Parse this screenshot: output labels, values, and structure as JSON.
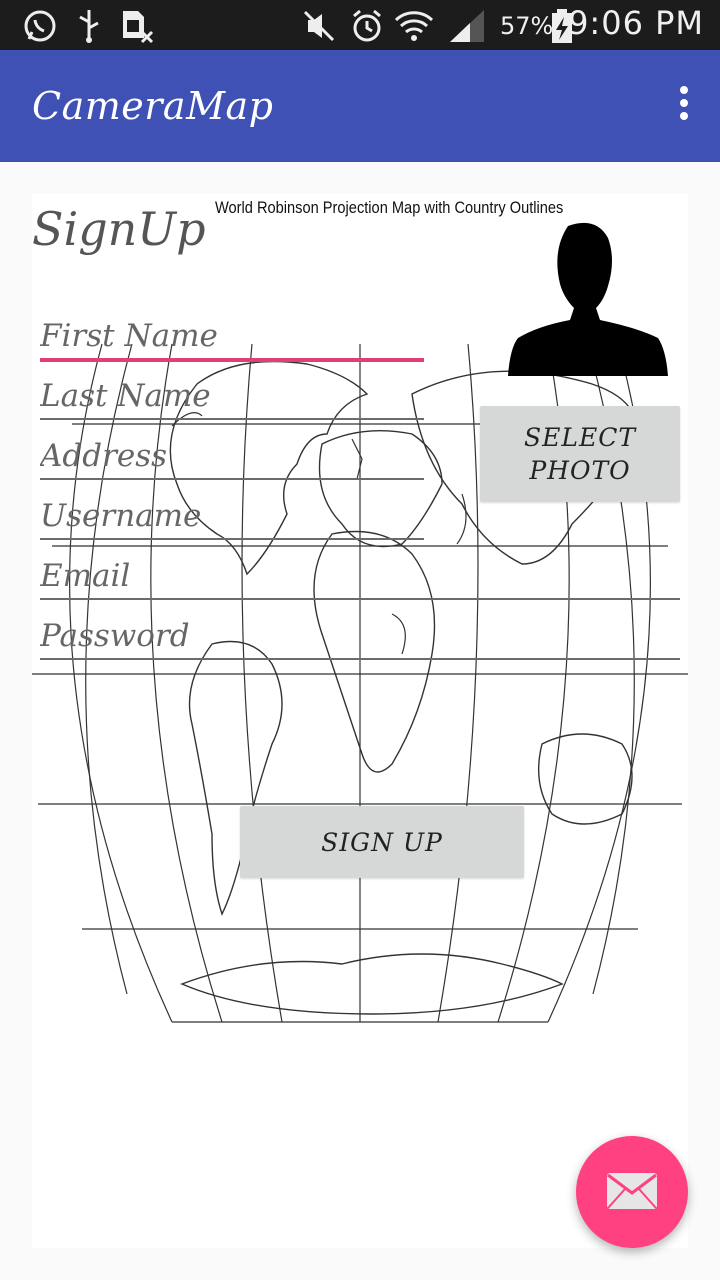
{
  "status_bar": {
    "battery_percent": "57%",
    "time": "9:06 PM",
    "icons": [
      "whatsapp-icon",
      "usb-icon",
      "sim-card-icon",
      "mute-icon",
      "alarm-icon",
      "wifi-icon",
      "signal-icon",
      "battery-charging-icon"
    ]
  },
  "app_bar": {
    "title": "CameraMap",
    "menu_icon": "more-vertical-icon"
  },
  "map": {
    "title": "World Robinson Projection Map with Country Outlines"
  },
  "form": {
    "heading": "SignUp",
    "fields": [
      {
        "placeholder": "First Name",
        "value": ""
      },
      {
        "placeholder": "Last Name",
        "value": ""
      },
      {
        "placeholder": "Address",
        "value": ""
      },
      {
        "placeholder": "Username",
        "value": ""
      },
      {
        "placeholder": "Email",
        "value": ""
      },
      {
        "placeholder": "Password",
        "value": ""
      }
    ],
    "select_photo_line1": "SELECT",
    "select_photo_line2": "PHOTO",
    "sign_up_label": "SIGN UP"
  },
  "fab": {
    "icon": "email-icon",
    "color": "#ff4081"
  },
  "colors": {
    "app_bar": "#3f51b5",
    "accent": "#e23f78",
    "button_bg": "#d6d7d7"
  }
}
